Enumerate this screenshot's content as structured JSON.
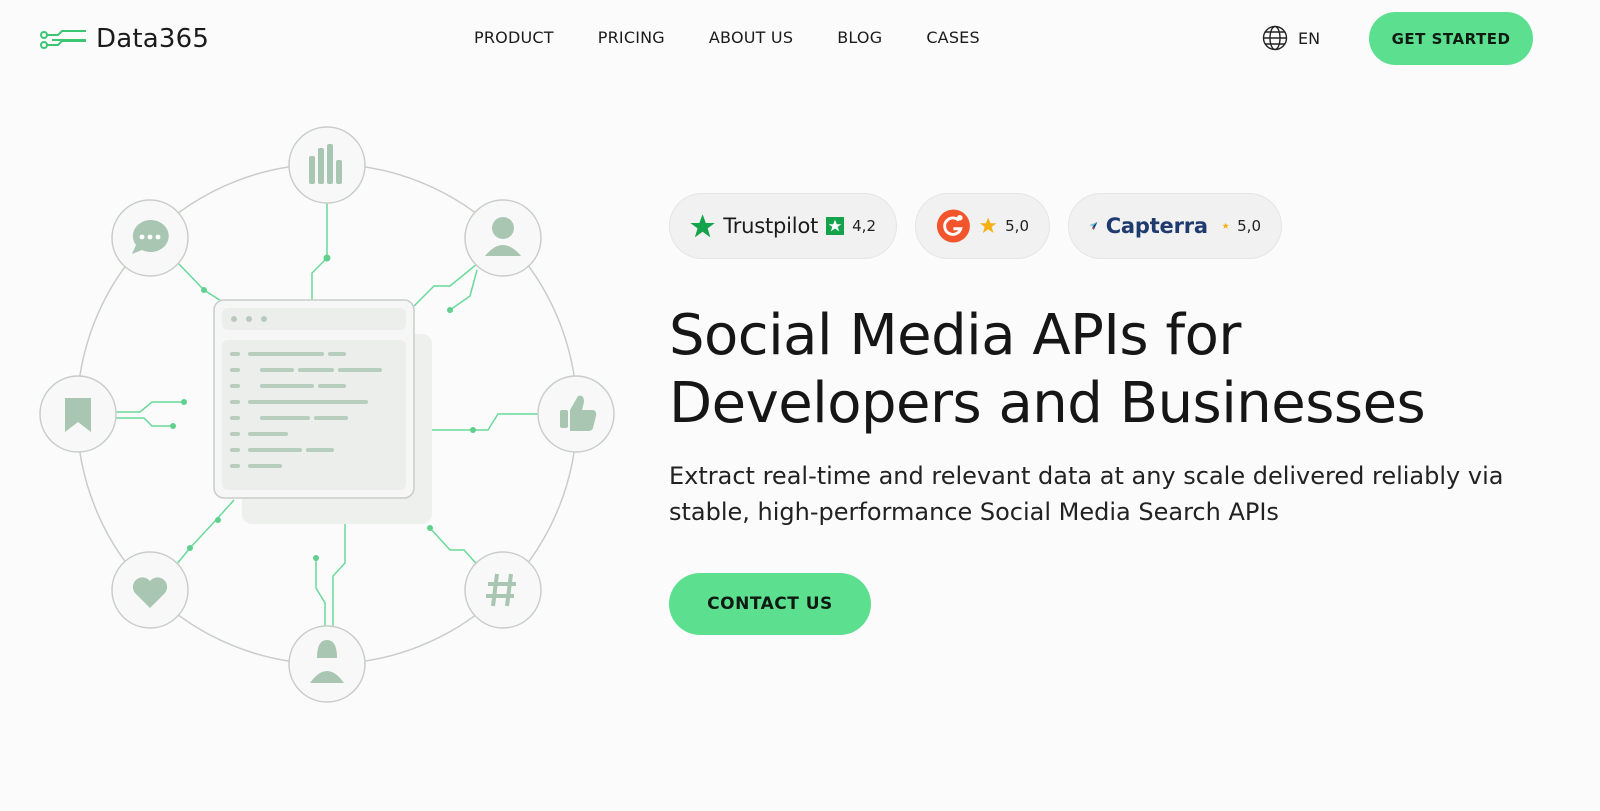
{
  "brand": {
    "name": "Data365",
    "accent_color": "#5ce08f",
    "icon": "circuit-logo-icon"
  },
  "nav": {
    "items": [
      {
        "label": "PRODUCT"
      },
      {
        "label": "PRICING"
      },
      {
        "label": "ABOUT US"
      },
      {
        "label": "BLOG"
      },
      {
        "label": "CASES"
      }
    ]
  },
  "language": {
    "label": "EN",
    "icon": "globe-icon"
  },
  "header": {
    "cta_label": "GET STARTED"
  },
  "ratings": {
    "trustpilot": {
      "name": "Trustpilot",
      "score": "4,2",
      "icon": "trustpilot-star-icon"
    },
    "g2": {
      "score": "5,0",
      "icon": "g2-logo-icon"
    },
    "capterra": {
      "name": "Capterra",
      "score": "5,0",
      "icon": "capterra-logo-icon"
    }
  },
  "hero": {
    "title": "Social Media APIs for Developers and Businesses",
    "subtitle": "Extract real-time and relevant data at any scale delivered reliably via stable, high-performance Social Media Search APIs",
    "cta_label": "CONTACT US"
  }
}
